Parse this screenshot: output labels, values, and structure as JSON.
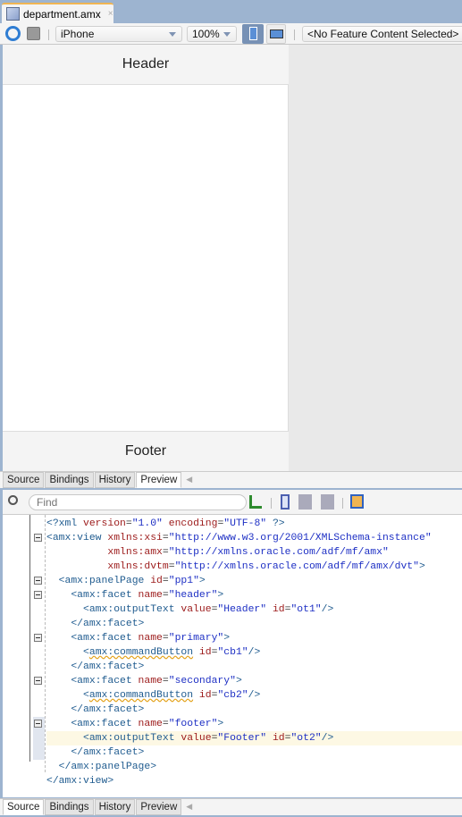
{
  "editor_tab": {
    "title": "department.amx",
    "close": "×"
  },
  "toolbar": {
    "device": "iPhone",
    "zoom": "100%",
    "feature": "<No Feature Content Selected>"
  },
  "preview": {
    "header": "Header",
    "footer": "Footer"
  },
  "tabs": [
    "Source",
    "Bindings",
    "History",
    "Preview"
  ],
  "top_active_tab": "Preview",
  "bottom_active_tab": "Source",
  "find": {
    "placeholder": "Find"
  },
  "colors": {
    "tag": "#1f5b8f",
    "attr": "#9c1a1a",
    "value": "#1d2fc4",
    "current_line": "#fdf8e4"
  },
  "code": [
    [
      [
        "tag",
        "<?xml "
      ],
      [
        "attr",
        "version"
      ],
      [
        "plain",
        "="
      ],
      [
        "val",
        "\"1.0\""
      ],
      [
        "plain",
        " "
      ],
      [
        "attr",
        "encoding"
      ],
      [
        "plain",
        "="
      ],
      [
        "val",
        "\"UTF-8\""
      ],
      [
        "tag",
        " ?>"
      ]
    ],
    [
      [
        "tag",
        "<amx:view "
      ],
      [
        "attr",
        "xmlns:xsi"
      ],
      [
        "plain",
        "="
      ],
      [
        "val",
        "\"http://www.w3.org/2001/XMLSchema-instance\""
      ]
    ],
    [
      [
        "plain",
        "          "
      ],
      [
        "attr",
        "xmlns:amx"
      ],
      [
        "plain",
        "="
      ],
      [
        "val",
        "\"http://xmlns.oracle.com/adf/mf/amx\""
      ]
    ],
    [
      [
        "plain",
        "          "
      ],
      [
        "attr",
        "xmlns:dvtm"
      ],
      [
        "plain",
        "="
      ],
      [
        "val",
        "\"http://xmlns.oracle.com/adf/mf/amx/dvt\""
      ],
      [
        "tag",
        ">"
      ]
    ],
    [
      [
        "plain",
        "  "
      ],
      [
        "tag",
        "<amx:panelPage "
      ],
      [
        "attr",
        "id"
      ],
      [
        "plain",
        "="
      ],
      [
        "val",
        "\"pp1\""
      ],
      [
        "tag",
        ">"
      ]
    ],
    [
      [
        "plain",
        "    "
      ],
      [
        "tag",
        "<amx:facet "
      ],
      [
        "attr",
        "name"
      ],
      [
        "plain",
        "="
      ],
      [
        "val",
        "\"header\""
      ],
      [
        "tag",
        ">"
      ]
    ],
    [
      [
        "plain",
        "      "
      ],
      [
        "tag",
        "<amx:outputText "
      ],
      [
        "attr",
        "value"
      ],
      [
        "plain",
        "="
      ],
      [
        "val",
        "\"Header\""
      ],
      [
        "plain",
        " "
      ],
      [
        "attr",
        "id"
      ],
      [
        "plain",
        "="
      ],
      [
        "val",
        "\"ot1\""
      ],
      [
        "tag",
        "/>"
      ]
    ],
    [
      [
        "plain",
        "    "
      ],
      [
        "tag",
        "</amx:facet>"
      ]
    ],
    [
      [
        "plain",
        "    "
      ],
      [
        "tag",
        "<amx:facet "
      ],
      [
        "attr",
        "name"
      ],
      [
        "plain",
        "="
      ],
      [
        "val",
        "\"primary\""
      ],
      [
        "tag",
        ">"
      ]
    ],
    [
      [
        "plain",
        "      "
      ],
      [
        "tag",
        "<"
      ],
      [
        "wavy",
        "amx:commandButton"
      ],
      [
        "tag",
        " "
      ],
      [
        "attr",
        "id"
      ],
      [
        "plain",
        "="
      ],
      [
        "val",
        "\"cb1\""
      ],
      [
        "tag",
        "/>"
      ]
    ],
    [
      [
        "plain",
        "    "
      ],
      [
        "tag",
        "</amx:facet>"
      ]
    ],
    [
      [
        "plain",
        "    "
      ],
      [
        "tag",
        "<amx:facet "
      ],
      [
        "attr",
        "name"
      ],
      [
        "plain",
        "="
      ],
      [
        "val",
        "\"secondary\""
      ],
      [
        "tag",
        ">"
      ]
    ],
    [
      [
        "plain",
        "      "
      ],
      [
        "tag",
        "<"
      ],
      [
        "wavy",
        "amx:commandButton"
      ],
      [
        "tag",
        " "
      ],
      [
        "attr",
        "id"
      ],
      [
        "plain",
        "="
      ],
      [
        "val",
        "\"cb2\""
      ],
      [
        "tag",
        "/>"
      ]
    ],
    [
      [
        "plain",
        "    "
      ],
      [
        "tag",
        "</amx:facet>"
      ]
    ],
    [
      [
        "plain",
        "    "
      ],
      [
        "tag",
        "<amx:facet "
      ],
      [
        "attr",
        "name"
      ],
      [
        "plain",
        "="
      ],
      [
        "val",
        "\"footer\""
      ],
      [
        "tag",
        ">"
      ]
    ],
    [
      [
        "plain",
        "      "
      ],
      [
        "tag",
        "<amx:outputText "
      ],
      [
        "attr",
        "value"
      ],
      [
        "plain",
        "="
      ],
      [
        "val",
        "\"Footer\""
      ],
      [
        "plain",
        " "
      ],
      [
        "attr",
        "id"
      ],
      [
        "plain",
        "="
      ],
      [
        "val",
        "\"ot2\""
      ],
      [
        "tag",
        "/>"
      ]
    ],
    [
      [
        "plain",
        "    "
      ],
      [
        "tag",
        "</amx:facet>"
      ]
    ],
    [
      [
        "plain",
        "  "
      ],
      [
        "tag",
        "</amx:panelPage>"
      ]
    ],
    [
      [
        "tag",
        "</amx:view>"
      ]
    ]
  ],
  "fold_lines": [
    1,
    4,
    5,
    8,
    11,
    14
  ],
  "current_line": 15
}
